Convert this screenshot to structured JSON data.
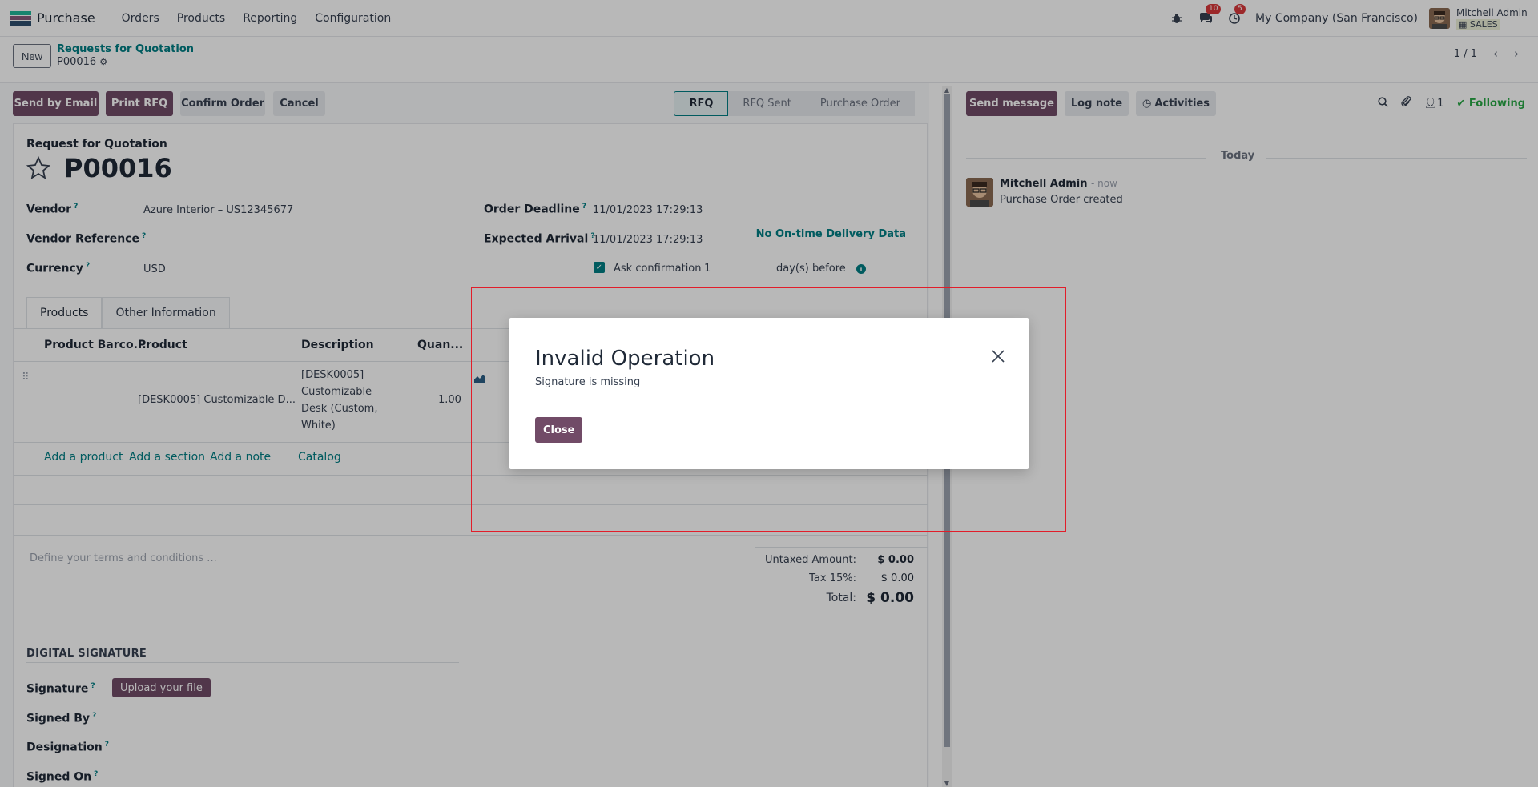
{
  "navbar": {
    "app_name": "Purchase",
    "menu": [
      "Orders",
      "Products",
      "Reporting",
      "Configuration"
    ],
    "messages_count": "10",
    "activities_count": "5",
    "company": "My Company (San Francisco)",
    "user_name": "Mitchell Admin",
    "db_name": "SALES"
  },
  "breadcrumb": {
    "new_label": "New",
    "parent": "Requests for Quotation",
    "current": "P00016"
  },
  "pager": {
    "value": "1 / 1"
  },
  "statusbar": {
    "buttons": [
      "Send by Email",
      "Print RFQ",
      "Confirm Order",
      "Cancel"
    ],
    "stages": [
      "RFQ",
      "RFQ Sent",
      "Purchase Order"
    ],
    "active_stage": "RFQ"
  },
  "form": {
    "caption": "Request for Quotation",
    "reference": "P00016",
    "vendor_label": "Vendor",
    "vendor_value": "Azure Interior – US12345677",
    "vendor_ref_label": "Vendor Reference",
    "currency_label": "Currency",
    "currency_value": "USD",
    "deadline_label": "Order Deadline",
    "deadline_value": "11/01/2023 17:29:13",
    "arrival_label": "Expected Arrival",
    "arrival_value": "11/01/2023 17:29:13",
    "ontime_label": "No On-time Delivery Data",
    "ask_confirmation_label": "Ask confirmation",
    "ask_confirmation_days": "1",
    "days_before_label": "day(s) before"
  },
  "tabs": [
    "Products",
    "Other Information"
  ],
  "table": {
    "headers": [
      "Product Barco...",
      "Product",
      "Description",
      "Quan..."
    ],
    "rows": [
      {
        "product": "[DESK0005] Customizable D...",
        "description_lines": [
          "[DESK0005]",
          "Customizable",
          "Desk (Custom,",
          "White)"
        ],
        "quantity": "1.00"
      }
    ],
    "add_links": [
      "Add a product",
      "Add a section",
      "Add a note",
      "Catalog"
    ]
  },
  "terms_placeholder": "Define your terms and conditions ...",
  "totals": {
    "untaxed_label": "Untaxed Amount:",
    "untaxed_value": "$ 0.00",
    "tax_label": "Tax 15%:",
    "tax_value": "$ 0.00",
    "total_label": "Total:",
    "total_value": "$ 0.00"
  },
  "signature": {
    "section_title": "DIGITAL SIGNATURE",
    "signature_label": "Signature",
    "upload_label": "Upload your file",
    "signed_by_label": "Signed By",
    "designation_label": "Designation",
    "signed_on_label": "Signed On"
  },
  "chatter": {
    "send_message": "Send message",
    "log_note": "Log note",
    "activities": "Activities",
    "followers_count": "1",
    "following_label": "Following",
    "date_separator": "Today",
    "message": {
      "author": "Mitchell Admin",
      "time": "- now",
      "body": "Purchase Order created"
    }
  },
  "dialog": {
    "title": "Invalid Operation",
    "body": "Signature is missing",
    "close_label": "Close"
  },
  "colors": {
    "brand": "#714b67",
    "accent": "#017e84",
    "badge": "#d9383b",
    "following": "#28a745"
  }
}
